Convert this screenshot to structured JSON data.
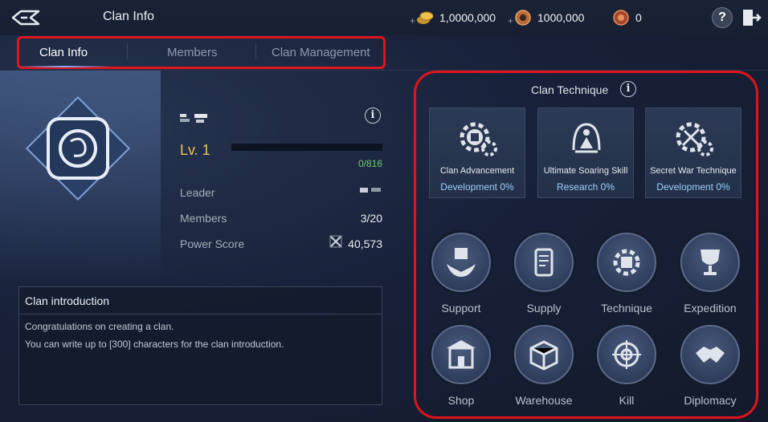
{
  "header": {
    "title": "Clan Info",
    "resources": [
      {
        "icon": "gold-coin-icon",
        "value": "1,0000,000"
      },
      {
        "icon": "ring-coin-icon",
        "value": "1000,000"
      },
      {
        "icon": "red-gem-icon",
        "value": "0"
      }
    ],
    "help_label": "?"
  },
  "tabs": [
    {
      "label": "Clan Info",
      "active": true
    },
    {
      "label": "Members",
      "active": false
    },
    {
      "label": "Clan Management",
      "active": false
    }
  ],
  "clan": {
    "level": "Lv. 1",
    "exp_text": "0/816",
    "exp_progress": 0,
    "leader_label": "Leader",
    "members_label": "Members",
    "members_value": "3/20",
    "power_label": "Power Score",
    "power_value": "40,573"
  },
  "intro": {
    "heading": "Clan introduction",
    "lines": [
      "Congratulations on creating a clan.",
      "You can write up to [300] characters for the clan introduction."
    ]
  },
  "technique": {
    "title": "Clan Technique",
    "cards": [
      {
        "name": "Clan Advancement",
        "status": "Development 0%"
      },
      {
        "name": "Ultimate Soaring Skill",
        "status": "Research 0%"
      },
      {
        "name": "Secret War Technique",
        "status": "Development 0%"
      }
    ],
    "functions": [
      {
        "label": "Support"
      },
      {
        "label": "Supply"
      },
      {
        "label": "Technique"
      },
      {
        "label": "Expedition"
      },
      {
        "label": "Shop"
      },
      {
        "label": "Warehouse"
      },
      {
        "label": "Kill"
      },
      {
        "label": "Diplomacy"
      }
    ]
  },
  "colors": {
    "accent_gold": "#e9c25c",
    "highlight_red": "#e0141c",
    "exp_green": "#6fd06f",
    "status_blue": "#9ad2ff"
  }
}
